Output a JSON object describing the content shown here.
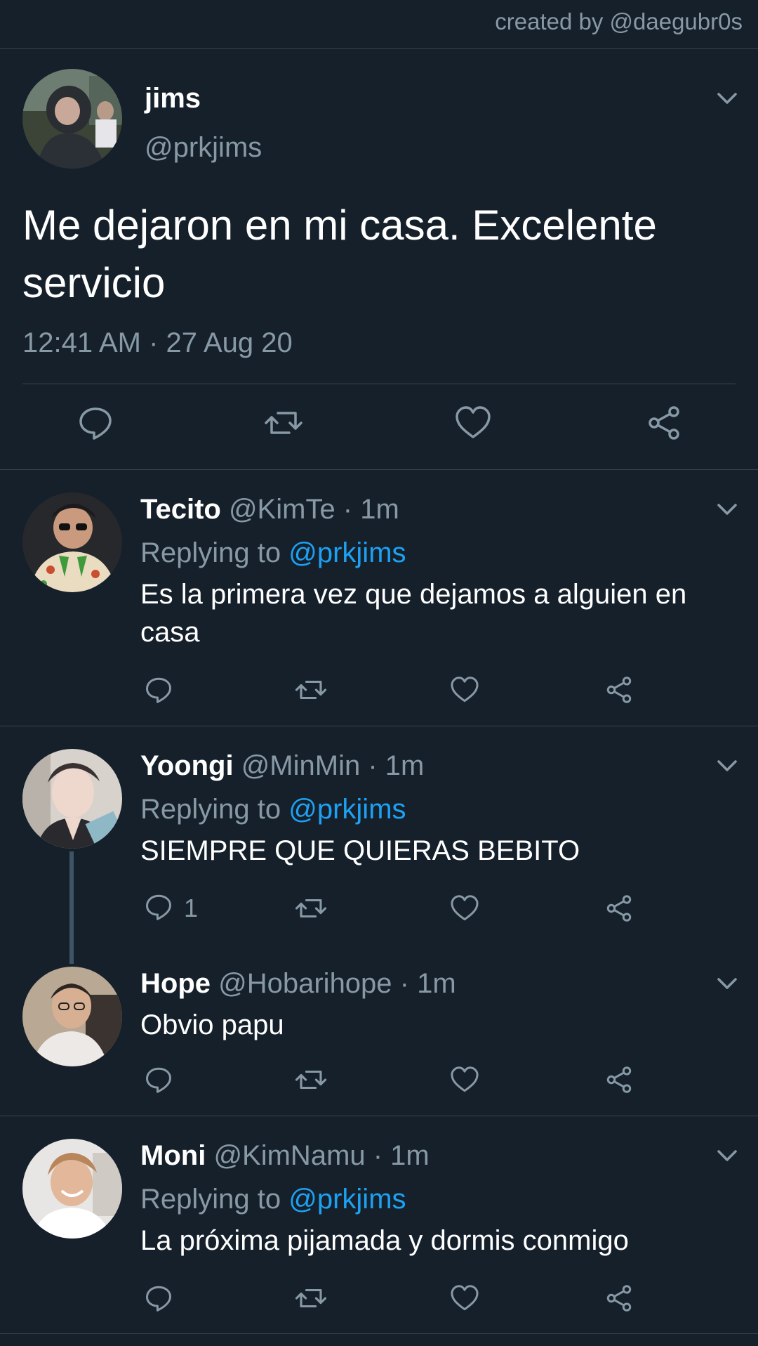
{
  "credit": "created by @daegubr0s",
  "main_tweet": {
    "name": "jims",
    "handle": "@prkjims",
    "text": "Me dejaron en mi casa. Excelente servicio",
    "timestamp": "12:41 AM · 27 Aug 20"
  },
  "replies": [
    {
      "name": "Tecito",
      "meta": "@KimTe · 1m",
      "replying_label": "Replying to",
      "replying_to": "@prkjims",
      "text": "Es la primera vez que dejamos a alguien en casa"
    },
    {
      "name": "Yoongi",
      "meta": "@MinMin · 1m",
      "replying_label": "Replying to",
      "replying_to": "@prkjims",
      "text": "SIEMPRE QUE QUIERAS BEBITO",
      "reply_count": "1"
    },
    {
      "name": "Hope",
      "meta": "@Hobarihope · 1m",
      "text": "Obvio papu"
    },
    {
      "name": "Moni",
      "meta": "@KimNamu · 1m",
      "replying_label": "Replying to",
      "replying_to": "@prkjims",
      "text": "La próxima pijamada y dormis conmigo"
    }
  ],
  "icons": [
    "chevron-down-icon",
    "reply-icon",
    "retweet-icon",
    "like-icon",
    "share-icon"
  ],
  "colors": {
    "background": "#15202b",
    "divider": "#38444d",
    "secondary_text": "#8899a6",
    "mention": "#1da1f2"
  }
}
